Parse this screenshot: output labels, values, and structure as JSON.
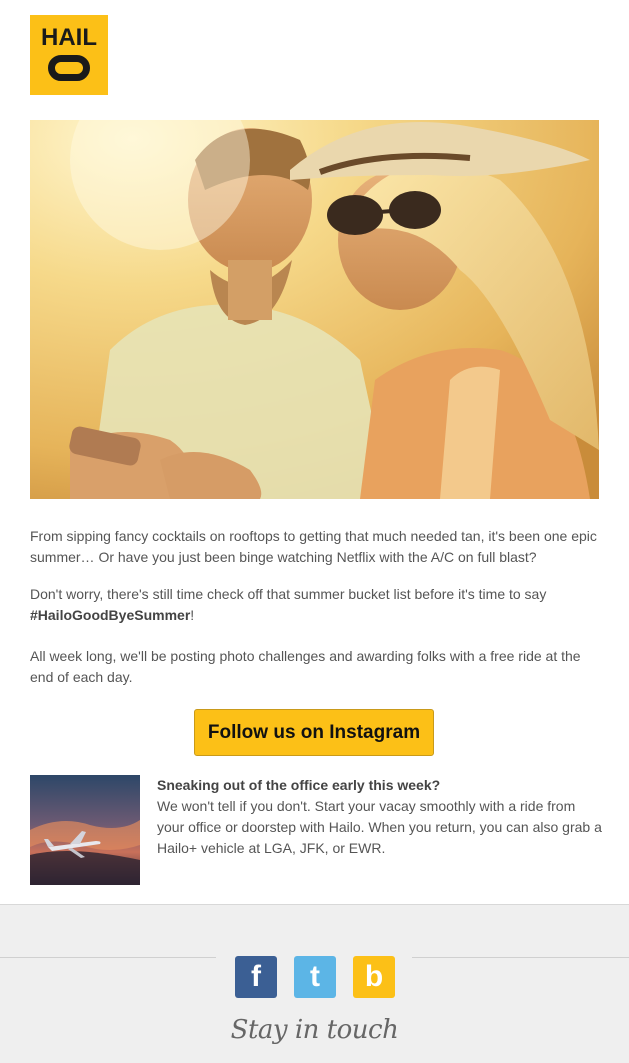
{
  "brand": {
    "logo_text": "HAIL O",
    "color": "#fcc017"
  },
  "hero": {
    "description": "Young couple smiling while looking at a phone in warm sunset light"
  },
  "content": {
    "paragraph1": "From sipping fancy cocktails on rooftops to getting that much needed tan, it's been one epic summer… Or have you just been binge watching Netflix with the A/C on full blast?",
    "paragraph2_before": "Don't worry, there's still time check off that summer bucket list before it's time to say ",
    "paragraph2_hashtag": "#HailoGoodByeSummer",
    "paragraph2_after": "!",
    "paragraph3": "All week long, we'll be posting photo challenges and awarding folks with a free ride at the end of each day."
  },
  "cta": {
    "label": "Follow us on Instagram",
    "color": "#fcc017"
  },
  "promo": {
    "title": "Sneaking out of the office early this week?",
    "body": "We won't tell if you don't. Start your vacay smoothly with a ride from your office or doorstep with Hailo. When you return, you can also grab a Hailo+ vehicle at LGA, JFK, or EWR."
  },
  "footer": {
    "social": [
      {
        "name": "facebook",
        "glyph": "f",
        "color": "#3b5f94"
      },
      {
        "name": "twitter",
        "glyph": "t",
        "color": "#5cb5e6"
      },
      {
        "name": "blog",
        "glyph": "b",
        "color": "#fcc017"
      }
    ],
    "tagline": "Stay in touch",
    "background": "#efefef"
  }
}
